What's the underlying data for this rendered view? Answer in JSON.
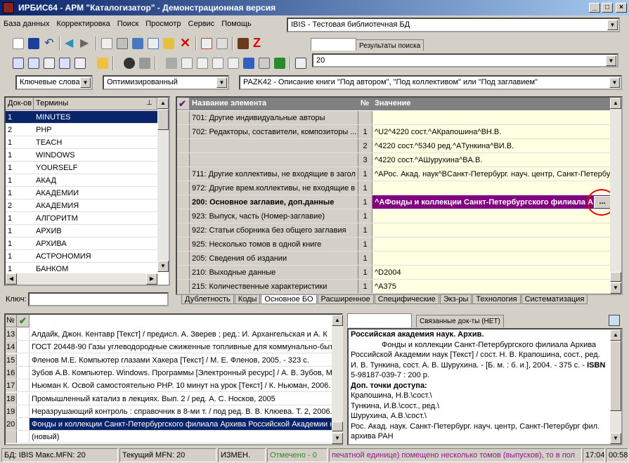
{
  "window": {
    "title": "ИРБИС64 - АРМ \"Каталогизатор\" - Демонстрационная версия",
    "min": "_",
    "max": "□",
    "close": "×"
  },
  "menu": [
    "База данных",
    "Корректировка",
    "Поиск",
    "Просмотр",
    "Сервис",
    "Помощь"
  ],
  "database_combo": "IBIS - Тестовая библиотечная БД",
  "mfn_tabs": [
    "Новый/MFN",
    "Результаты поиска"
  ],
  "mfn_value": "20",
  "search_combo": "Ключевые слова",
  "worksheet_combo": "Оптимизированный",
  "template_combo": "PAZK42 - Описание книги \"Под автором\", \"Под коллективом\" или \"Под заглавием\"",
  "dict": {
    "col_docs": "Док-ов",
    "col_terms": "Термины",
    "rows": [
      {
        "n": "1",
        "t": "MINUTES"
      },
      {
        "n": "2",
        "t": "PHP"
      },
      {
        "n": "1",
        "t": "TEACH"
      },
      {
        "n": "1",
        "t": "WINDOWS"
      },
      {
        "n": "1",
        "t": "YOURSELF"
      },
      {
        "n": "1",
        "t": "АКАД"
      },
      {
        "n": "1",
        "t": "АКАДЕМИИ"
      },
      {
        "n": "2",
        "t": "АКАДЕМИЯ"
      },
      {
        "n": "1",
        "t": "АЛГОРИТМ"
      },
      {
        "n": "1",
        "t": "АРХИВ"
      },
      {
        "n": "1",
        "t": "АРХИВА"
      },
      {
        "n": "1",
        "t": "АСТРОНОМИЯ"
      },
      {
        "n": "1",
        "t": "БАНКОМ"
      }
    ],
    "key_label": "Ключ:",
    "key_value": ""
  },
  "editor": {
    "col_name": "Название элемента",
    "col_num": "№",
    "col_value": "Значение",
    "rows": [
      {
        "name": "701: Другие индивидуальные авторы",
        "num": "",
        "value": ""
      },
      {
        "name": "702: Редакторы, составители, композиторы ...",
        "num": "1",
        "value": "^U2^4220 сост.^AКрапошина^BН.В."
      },
      {
        "name": "",
        "num": "2",
        "value": "^4220 сост.^5340 ред.^AТункина^BИ.В."
      },
      {
        "name": "",
        "num": "3",
        "value": "^4220 сост.^AШурухина^BА.В."
      },
      {
        "name": "711: Другие коллективы, не входящие в загол",
        "num": "1",
        "value": "^AРос. Акад. наук^BСанкт-Петербург. науч. центр, Санкт-Петербу"
      },
      {
        "name": "972: Другие врем.коллективы, не входящие в",
        "num": "1",
        "value": ""
      },
      {
        "name": "200: Основное заглавие, доп.данные",
        "num": "1",
        "value": "^AФонды и коллекции Санкт-Петербургского филиала А"
      },
      {
        "name": "923: Выпуск, часть (Номер-заглавие)",
        "num": "1",
        "value": ""
      },
      {
        "name": "922: Статьи сборника без общего заглавия",
        "num": "1",
        "value": ""
      },
      {
        "name": "925: Несколько томов в одной книге",
        "num": "1",
        "value": ""
      },
      {
        "name": "205: Сведения об издании",
        "num": "1",
        "value": ""
      },
      {
        "name": "210: Выходные данные",
        "num": "1",
        "value": "^D2004"
      },
      {
        "name": "215: Количественные характеристики",
        "num": "1",
        "value": "^A375"
      }
    ],
    "ellipsis": "...",
    "tabs": [
      "Дублетность",
      "Коды",
      "Основное БО",
      "Расширенное",
      "Специфические",
      "Экз-ры",
      "Технология",
      "Систематизация"
    ]
  },
  "results": {
    "col_num": "№",
    "rows": [
      {
        "n": "13",
        "t": "Алдайк, Джон. Кентавр [Текст] / предисл. А. Зверев ; ред.: И. Архангельская и А. К"
      },
      {
        "n": "14",
        "t": "ГОСТ 20448-90 Газы углеводородные сжиженные топливные для коммунально-быт"
      },
      {
        "n": "15",
        "t": "Фленов М.Е. Компьютер глазами Хакера [Текст] / М. Е. Фленов, 2005. - 323 с."
      },
      {
        "n": "16",
        "t": "Зубов А.В. Компьютер. Windows. Программы [Электронный ресурс] / А. В. Зубов, М"
      },
      {
        "n": "17",
        "t": "Ньюман К. Освой самостоятельно PHP. 10 минут на урок [Текст] / К. Ньюман, 2006."
      },
      {
        "n": "18",
        "t": "Промышленный катализ в лекциях. Вып. 2 / ред. А. С. Носков, 2005"
      },
      {
        "n": "19",
        "t": "Неразрушающий контроль : справочник в 8-ми т. / под ред. В. В. Клюева. Т. 2, 2006."
      },
      {
        "n": "20",
        "t": "Фонды и коллекции Санкт-Петербургского филиала Архива Российской Академии н"
      },
      {
        "n": "",
        "t": "(новый)"
      }
    ]
  },
  "desc": {
    "tabs": [
      "Полное описание",
      "Связанные док-ты (НЕТ)"
    ],
    "line1": "Российская академия наук. Архив.",
    "body": "Фонды и коллекции Санкт-Петербургского филиала Архива Российской Академии наук [Текст] / сост. Н. В. Крапошина, сост., ред. И. В. Тункина, сост. А. В. Шурухина. - [Б. м. : б. и.], 2004. - 375 с. - ",
    "isbn_label": "ISBN",
    "isbn": " 5-98187-039-7 : 200 р.",
    "access_label": "Доп. точки доступа:",
    "access": [
      "Крапошина, Н.В.\\сост.\\",
      "Тункина, И.В.\\сост., ред.\\",
      "Шурухина, А.В.\\сост.\\",
      "Рос. Акад. наук. Санкт-Петербург. науч. центр, Санкт-Петербург фил. архива РАН"
    ]
  },
  "status": {
    "db": "БД: IBIS Макс.MFN: 20",
    "current": "Текущий MFN: 20",
    "changed": "ИЗМЕН.",
    "marked": "Отмечено - 0",
    "message": "печатной единице) помещено несколько томов (выпусков), то в пол",
    "time1": "17:04",
    "time2": "00:58"
  },
  "colors": {
    "title_start": "#0a246a",
    "selection": "#0a246a",
    "highlight_row": "#800080",
    "editor_value_bg": "#ffffe1",
    "annotation_circle": "#e00000"
  }
}
